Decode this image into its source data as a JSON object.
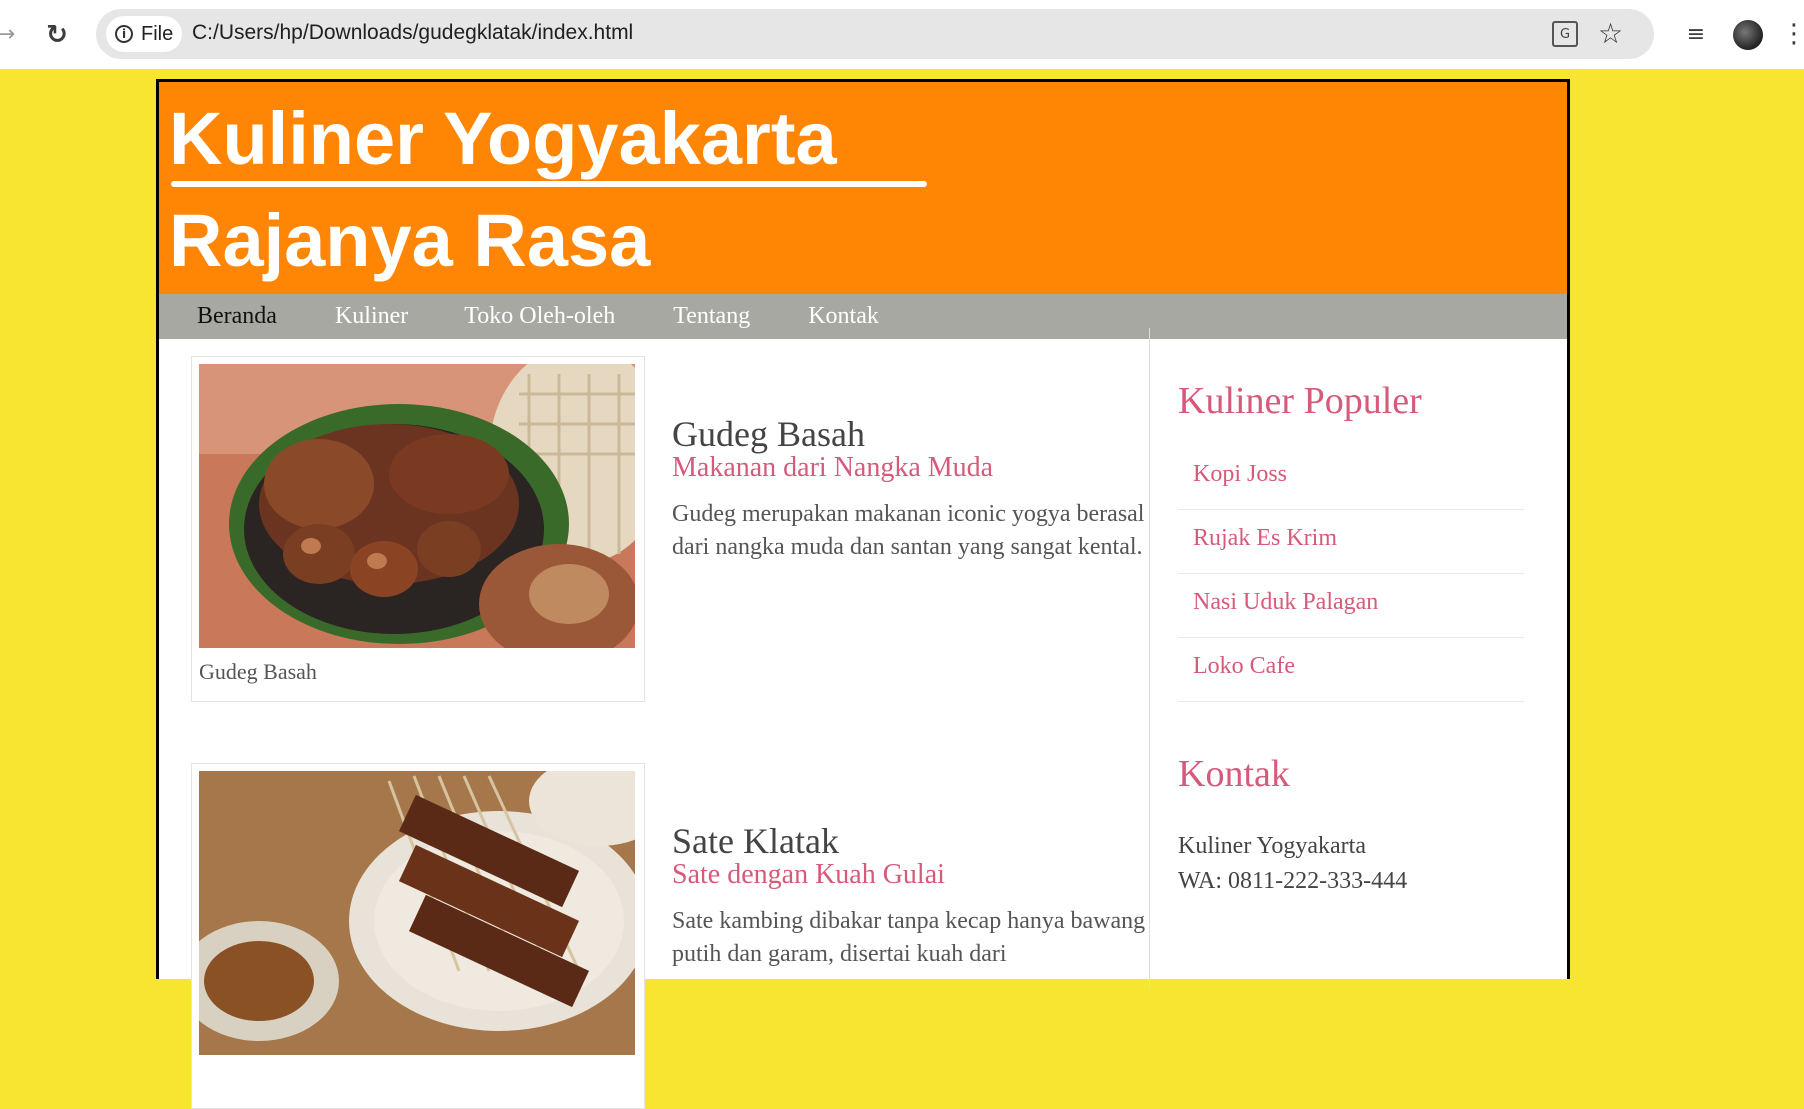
{
  "browser": {
    "file_label": "File",
    "url": "C:/Users/hp/Downloads/gudegklatak/index.html"
  },
  "banner": {
    "line1": "Kuliner Yogyakarta",
    "line2": "Rajanya Rasa"
  },
  "nav": {
    "items": [
      "Beranda",
      "Kuliner",
      "Toko Oleh-oleh",
      "Tentang",
      "Kontak"
    ]
  },
  "articles": [
    {
      "caption": "Gudeg Basah",
      "title": "Gudeg Basah",
      "subtitle": "Makanan dari Nangka Muda",
      "description": "Gudeg merupakan makanan iconic yogya berasal dari nangka muda dan santan yang sangat kental."
    },
    {
      "caption": "",
      "title": "Sate Klatak",
      "subtitle": "Sate dengan Kuah Gulai",
      "description": "Sate kambing dibakar tanpa kecap hanya bawang putih dan garam, disertai kuah dari"
    }
  ],
  "sidebar": {
    "popular_heading": "Kuliner Populer",
    "popular_items": [
      "Kopi Joss",
      "Rujak Es Krim",
      "Nasi Uduk Palagan",
      "Loko Cafe"
    ],
    "contact_heading": "Kontak",
    "contact_name": "Kuliner Yogyakarta",
    "contact_wa": "WA: 0811-222-333-444"
  },
  "colors": {
    "page_background": "#f8e531",
    "banner": "#ff8605",
    "nav": "#a8a8a2",
    "accent_pink": "#d65a7a"
  }
}
